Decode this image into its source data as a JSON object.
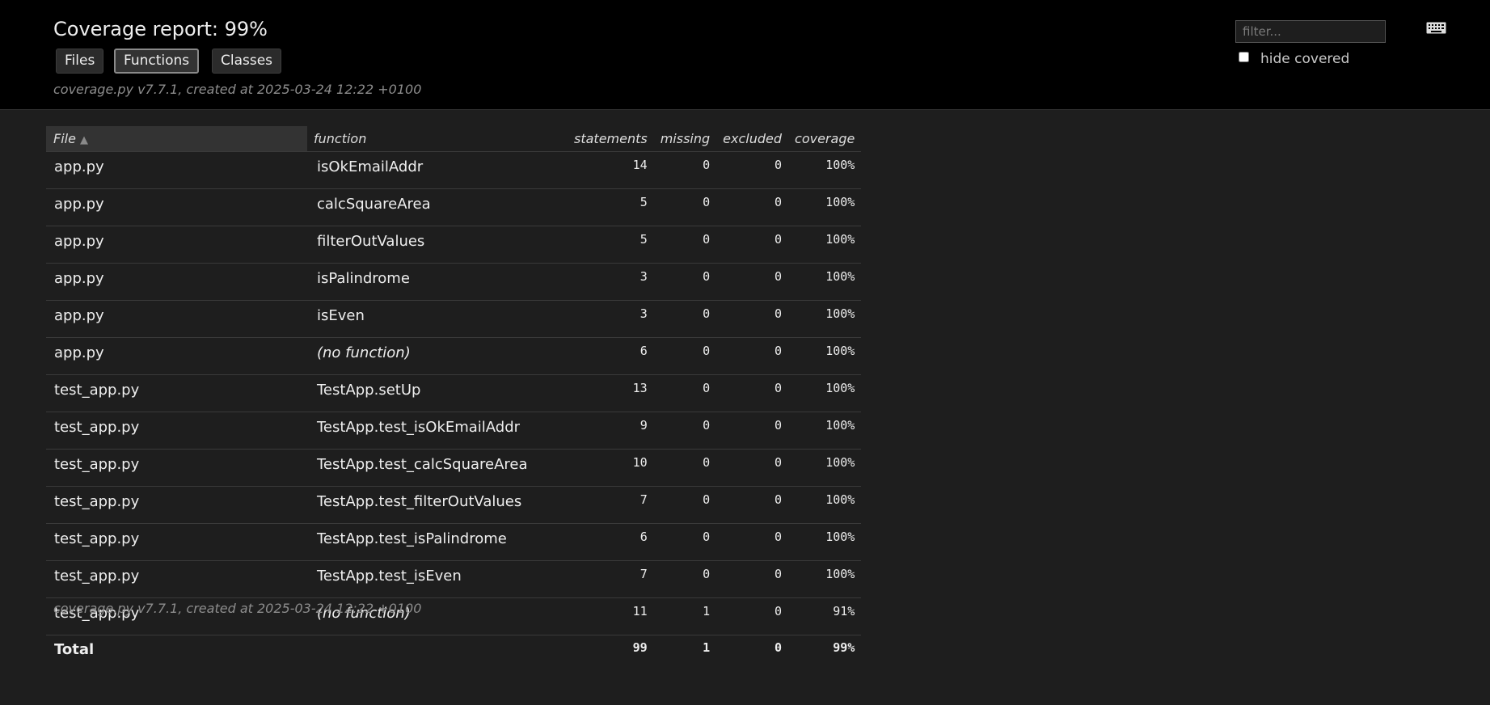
{
  "header": {
    "title": "Coverage report: 99%",
    "nav": {
      "files": "Files",
      "functions": "Functions",
      "classes": "Classes"
    },
    "created": "coverage.py v7.7.1, created at 2025-03-24 12:22 +0100",
    "filter_placeholder": "filter...",
    "hide_covered_label": "hide covered",
    "keyboard_icon": "keyboard-icon"
  },
  "table": {
    "columns": {
      "file": "File",
      "function": "function",
      "statements": "statements",
      "missing": "missing",
      "excluded": "excluded",
      "coverage": "coverage"
    },
    "sort_arrow": "▲",
    "rows": [
      {
        "file": "app.py",
        "function": "isOkEmailAddr",
        "statements": "14",
        "missing": "0",
        "excluded": "0",
        "coverage": "100%"
      },
      {
        "file": "app.py",
        "function": "calcSquareArea",
        "statements": "5",
        "missing": "0",
        "excluded": "0",
        "coverage": "100%"
      },
      {
        "file": "app.py",
        "function": "filterOutValues",
        "statements": "5",
        "missing": "0",
        "excluded": "0",
        "coverage": "100%"
      },
      {
        "file": "app.py",
        "function": "isPalindrome",
        "statements": "3",
        "missing": "0",
        "excluded": "0",
        "coverage": "100%"
      },
      {
        "file": "app.py",
        "function": "isEven",
        "statements": "3",
        "missing": "0",
        "excluded": "0",
        "coverage": "100%"
      },
      {
        "file": "app.py",
        "function": "(no function)",
        "statements": "6",
        "missing": "0",
        "excluded": "0",
        "coverage": "100%"
      },
      {
        "file": "test_app.py",
        "function": "TestApp.setUp",
        "statements": "13",
        "missing": "0",
        "excluded": "0",
        "coverage": "100%"
      },
      {
        "file": "test_app.py",
        "function": "TestApp.test_isOkEmailAddr",
        "statements": "9",
        "missing": "0",
        "excluded": "0",
        "coverage": "100%"
      },
      {
        "file": "test_app.py",
        "function": "TestApp.test_calcSquareArea",
        "statements": "10",
        "missing": "0",
        "excluded": "0",
        "coverage": "100%"
      },
      {
        "file": "test_app.py",
        "function": "TestApp.test_filterOutValues",
        "statements": "7",
        "missing": "0",
        "excluded": "0",
        "coverage": "100%"
      },
      {
        "file": "test_app.py",
        "function": "TestApp.test_isPalindrome",
        "statements": "6",
        "missing": "0",
        "excluded": "0",
        "coverage": "100%"
      },
      {
        "file": "test_app.py",
        "function": "TestApp.test_isEven",
        "statements": "7",
        "missing": "0",
        "excluded": "0",
        "coverage": "100%"
      },
      {
        "file": "test_app.py",
        "function": "(no function)",
        "statements": "11",
        "missing": "1",
        "excluded": "0",
        "coverage": "91%"
      }
    ],
    "total": {
      "label": "Total",
      "statements": "99",
      "missing": "1",
      "excluded": "0",
      "coverage": "99%"
    }
  },
  "footer": {
    "created": "coverage.py v7.7.1, created at 2025-03-24 12:22 +0100"
  }
}
